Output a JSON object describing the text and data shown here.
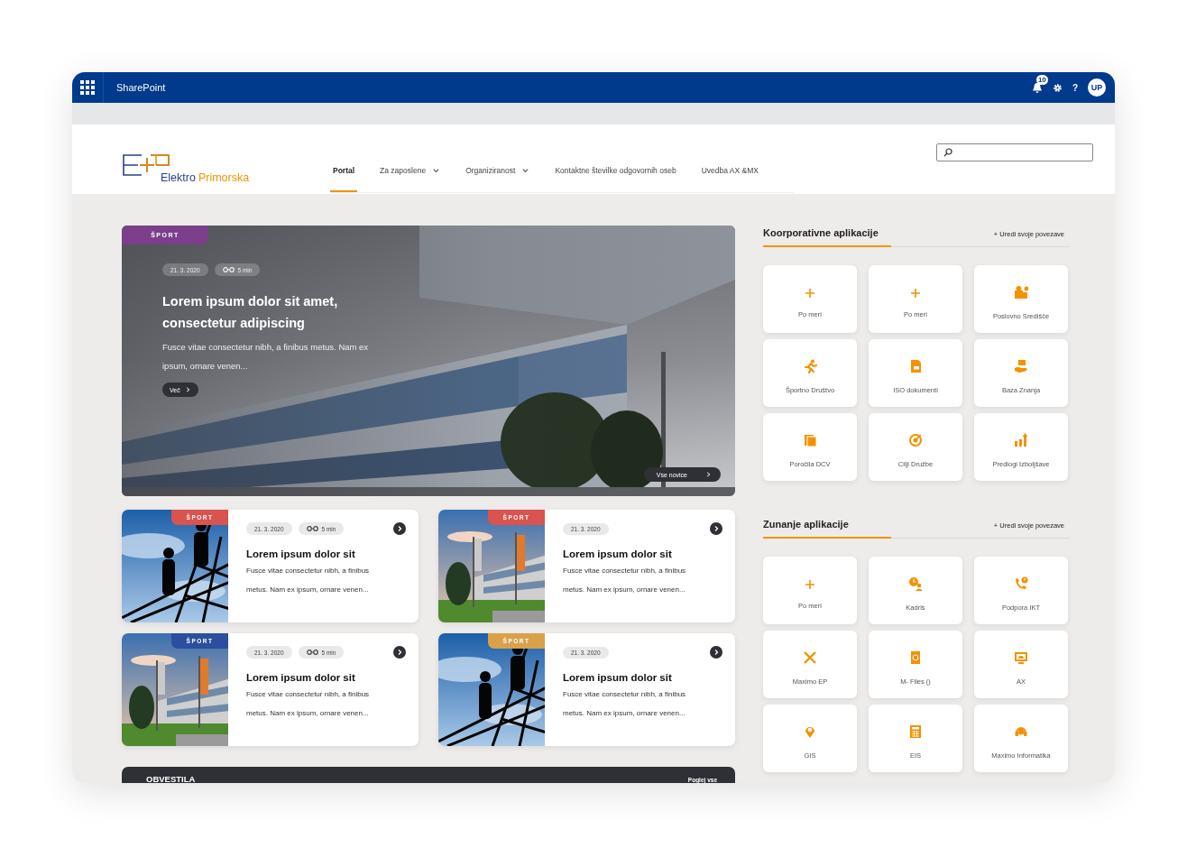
{
  "top_bar": {
    "app_name": "SharePoint",
    "notification_count": "10",
    "help": "?",
    "avatar": "UP"
  },
  "header": {
    "logo": {
      "part1": "Elektro",
      "part2": "Primorska"
    },
    "nav": [
      {
        "label": "Portal",
        "selected": true,
        "dropdown": false
      },
      {
        "label": "Za zaposlene",
        "selected": false,
        "dropdown": true
      },
      {
        "label": "Organiziranost",
        "selected": false,
        "dropdown": true
      },
      {
        "label": "Kontaktne številke odgovornih oseb",
        "selected": false,
        "dropdown": false
      },
      {
        "label": "Uvedba AX &MX",
        "selected": false,
        "dropdown": false
      }
    ]
  },
  "featured": {
    "tag": "ŠPORT",
    "date": "21. 3. 2020",
    "read_time": "5 min",
    "title": "Lorem ipsum dolor sit amet, consectetur adipiscing",
    "excerpt": "Fusce vitae consectetur nibh, a finibus metus. Nam ex ipsum, ornare venen...",
    "more": "Več",
    "all_news": "Vse novice"
  },
  "cards": [
    {
      "tag": "ŠPORT",
      "color": "#d9534f",
      "date": "21. 3. 2020",
      "read_time": "5 min",
      "title": "Lorem ipsum dolor sit",
      "excerpt": "Fusce vitae consectetur nibh, a finibus metus. Nam ex ipsum, ornare venen..."
    },
    {
      "tag": "ŠPORT",
      "color": "#d9534f",
      "date": "21. 3. 2020",
      "title": "Lorem ipsum dolor sit",
      "excerpt": "Fusce vitae consectetur nibh, a finibus metus. Nam ex ipsum, ornare venen..."
    },
    {
      "tag": "ŠPORT",
      "color": "#2b4f9e",
      "date": "21. 3. 2020",
      "read_time": "5 min",
      "title": "Lorem ipsum dolor sit",
      "excerpt": "Fusce vitae consectetur nibh, a finibus metus. Nam ex ipsum, ornare venen..."
    },
    {
      "tag": "ŠPORT",
      "color": "#d9a24a",
      "date": "21. 3. 2020",
      "title": "Lorem ipsum dolor sit",
      "excerpt": "Fusce vitae consectetur nibh, a finibus metus. Nam ex ipsum, ornare venen..."
    }
  ],
  "announcements": {
    "title": "OBVESTILA",
    "link": "Poglej vse"
  },
  "app_sections": [
    {
      "title": "Koorporativne aplikacije",
      "edit_link": "+ Uredi svoje povezave",
      "tiles": [
        {
          "kind": "add",
          "label": "Po meri"
        },
        {
          "kind": "add",
          "label": "Po meri"
        },
        {
          "kind": "app",
          "label": "Poslovno Središče"
        },
        {
          "kind": "app",
          "label": "Športno Društvo"
        },
        {
          "kind": "app",
          "label": "ISO dokumenti"
        },
        {
          "kind": "app",
          "label": "Baza Znanja"
        },
        {
          "kind": "app",
          "label": "Poročila DCV"
        },
        {
          "kind": "app",
          "label": "Cilji Družbe"
        },
        {
          "kind": "app",
          "label": "Predlogi Izboljšave"
        }
      ]
    },
    {
      "title": "Zunanje aplikacije",
      "edit_link": "+ Uredi svoje povezave",
      "tiles": [
        {
          "kind": "add",
          "label": "Po meri"
        },
        {
          "kind": "app",
          "label": "Kadris"
        },
        {
          "kind": "app",
          "label": "Podpora IKT"
        },
        {
          "kind": "app",
          "label": "Maximo EP"
        },
        {
          "kind": "app",
          "label": "M- Files ()"
        },
        {
          "kind": "app",
          "label": "AX"
        },
        {
          "kind": "app",
          "label": "GIS"
        },
        {
          "kind": "app",
          "label": "EIS"
        },
        {
          "kind": "app",
          "label": "Maximo Informatika"
        }
      ]
    }
  ]
}
